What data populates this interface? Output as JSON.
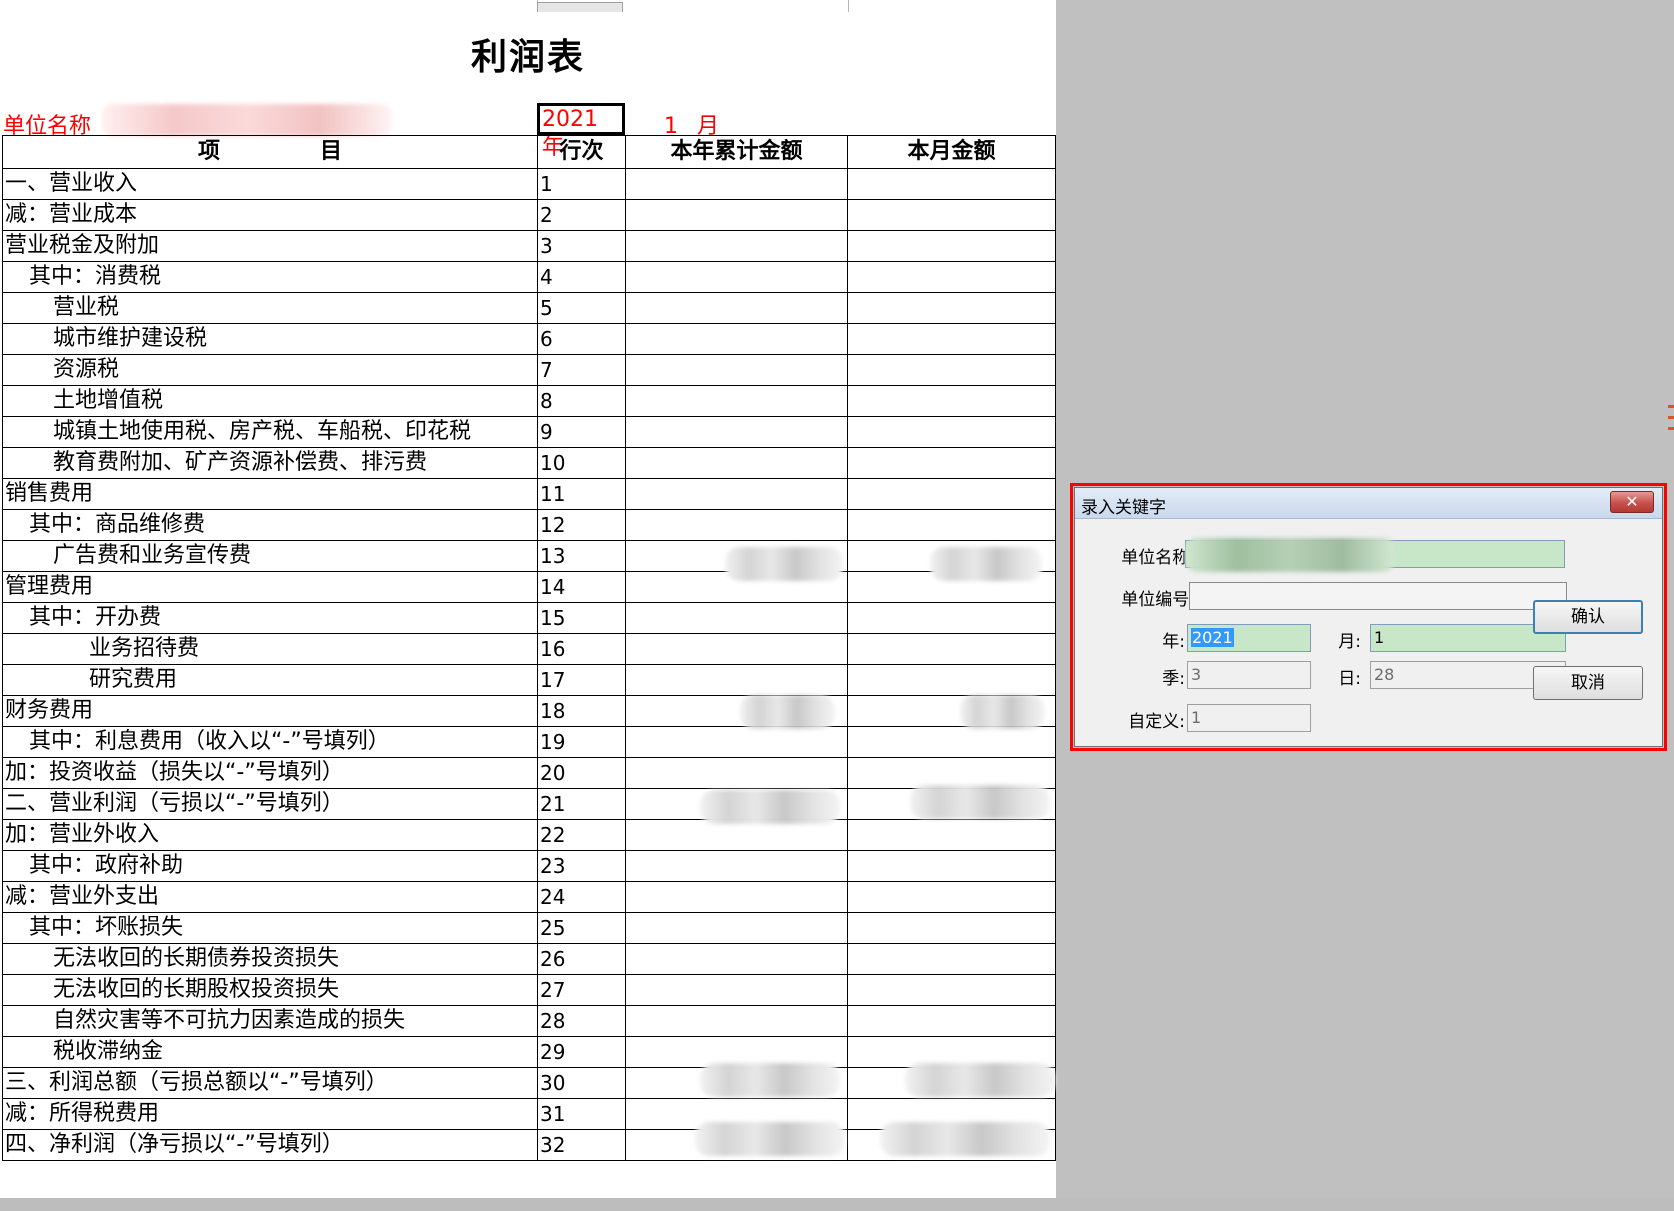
{
  "report": {
    "title": "利润表",
    "unit_label": "单位名称",
    "year_value": "2021 年",
    "month_value": "1",
    "month_unit": "月"
  },
  "table": {
    "headers": [
      "项",
      "目",
      "行次",
      "本年累计金额",
      "本月金额"
    ],
    "rows": [
      {
        "item": "一、营业收入",
        "line": "1",
        "indent": 0
      },
      {
        "item": "减：营业成本",
        "line": "2",
        "indent": 0
      },
      {
        "item": "营业税金及附加",
        "line": "3",
        "indent": 0
      },
      {
        "item": "其中：消费税",
        "line": "4",
        "indent": 1
      },
      {
        "item": "营业税",
        "line": "5",
        "indent": 2
      },
      {
        "item": "城市维护建设税",
        "line": "6",
        "indent": 2
      },
      {
        "item": "资源税",
        "line": "7",
        "indent": 2
      },
      {
        "item": "土地增值税",
        "line": "8",
        "indent": 2
      },
      {
        "item": "城镇土地使用税、房产税、车船税、印花税",
        "line": "9",
        "indent": 2
      },
      {
        "item": "教育费附加、矿产资源补偿费、排污费",
        "line": "10",
        "indent": 2
      },
      {
        "item": "销售费用",
        "line": "11",
        "indent": 0
      },
      {
        "item": "其中：商品维修费",
        "line": "12",
        "indent": 1
      },
      {
        "item": "广告费和业务宣传费",
        "line": "13",
        "indent": 2
      },
      {
        "item": "管理费用",
        "line": "14",
        "indent": 0
      },
      {
        "item": "其中：开办费",
        "line": "15",
        "indent": 1
      },
      {
        "item": "业务招待费",
        "line": "16",
        "indent": 3
      },
      {
        "item": "研究费用",
        "line": "17",
        "indent": 3
      },
      {
        "item": "财务费用",
        "line": "18",
        "indent": 0
      },
      {
        "item": "其中：利息费用（收入以“-”号填列）",
        "line": "19",
        "indent": 1
      },
      {
        "item": "加：投资收益（损失以“-”号填列）",
        "line": "20",
        "indent": 0
      },
      {
        "item": "二、营业利润（亏损以“-”号填列）",
        "line": "21",
        "indent": 0
      },
      {
        "item": "加：营业外收入",
        "line": "22",
        "indent": 0
      },
      {
        "item": "其中：政府补助",
        "line": "23",
        "indent": 1
      },
      {
        "item": "减：营业外支出",
        "line": "24",
        "indent": 0
      },
      {
        "item": "其中：坏账损失",
        "line": "25",
        "indent": 1
      },
      {
        "item": "无法收回的长期债券投资损失",
        "line": "26",
        "indent": 2
      },
      {
        "item": "无法收回的长期股权投资损失",
        "line": "27",
        "indent": 2
      },
      {
        "item": "自然灾害等不可抗力因素造成的损失",
        "line": "28",
        "indent": 2
      },
      {
        "item": "税收滞纳金",
        "line": "29",
        "indent": 2
      },
      {
        "item": "三、利润总额（亏损总额以“-”号填列）",
        "line": "30",
        "indent": 0
      },
      {
        "item": "减：所得税费用",
        "line": "31",
        "indent": 0
      },
      {
        "item": "四、净利润（净亏损以“-”号填列）",
        "line": "32",
        "indent": 0
      }
    ]
  },
  "dialog": {
    "title": "录入关键字",
    "close_icon": "close-icon",
    "labels": {
      "unit_name": "单位名称:",
      "unit_code": "单位编号:",
      "year": "年:",
      "month": "月:",
      "quarter": "季:",
      "day": "日:",
      "custom": "自定义:"
    },
    "fields": {
      "unit_code": "",
      "year": "2021",
      "month": "1",
      "quarter": "3",
      "day": "28",
      "custom": "1"
    },
    "buttons": {
      "confirm": "确认",
      "cancel": "取消"
    }
  },
  "colors": {
    "desktop_bg": "#c0c0c0",
    "red_text": "#ff0000",
    "highlight_border": "#ff0000",
    "field_green": "#c8e6c8",
    "selection": "#3399ff"
  }
}
